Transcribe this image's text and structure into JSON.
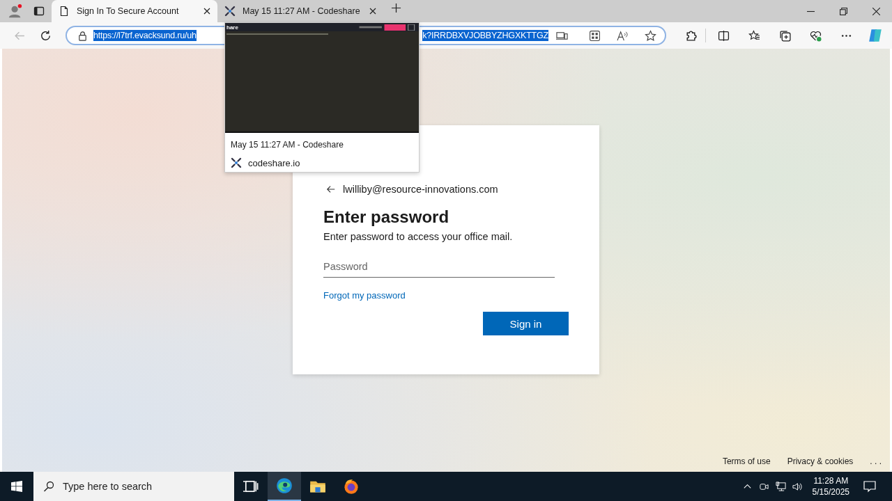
{
  "browser": {
    "tabs": [
      {
        "title": "Sign In To Secure Account",
        "selected": true,
        "kind": "page"
      },
      {
        "title": "May 15 11:27 AM - Codeshare",
        "selected": false,
        "kind": "codeshare"
      }
    ],
    "address": {
      "url_start": "https://l7trf.evacksund.ru/uh",
      "url_end": "k?IRRDBXVJOBBYZHGXKTTGZ",
      "selected": true
    },
    "tab_preview": {
      "page_title": "hare",
      "title": "May 15 11:27 AM - Codeshare",
      "site": "codeshare.io"
    }
  },
  "signin": {
    "account": "lwilliby@resource-innovations.com",
    "heading": "Enter password",
    "description": "Enter password to access your office mail.",
    "password_placeholder": "Password",
    "forgot_link": "Forgot my password",
    "submit": "Sign in"
  },
  "footer": {
    "links": [
      "Terms of use",
      "Privacy & cookies"
    ],
    "more": ". . ."
  },
  "taskbar": {
    "search_placeholder": "Type here to search",
    "apps": [
      {
        "kind": "taskview",
        "active": false
      },
      {
        "kind": "edge",
        "active": true
      },
      {
        "kind": "folder",
        "active": false
      },
      {
        "kind": "firefox",
        "active": false
      }
    ],
    "time": "11:28 AM",
    "date": "5/15/2025"
  }
}
